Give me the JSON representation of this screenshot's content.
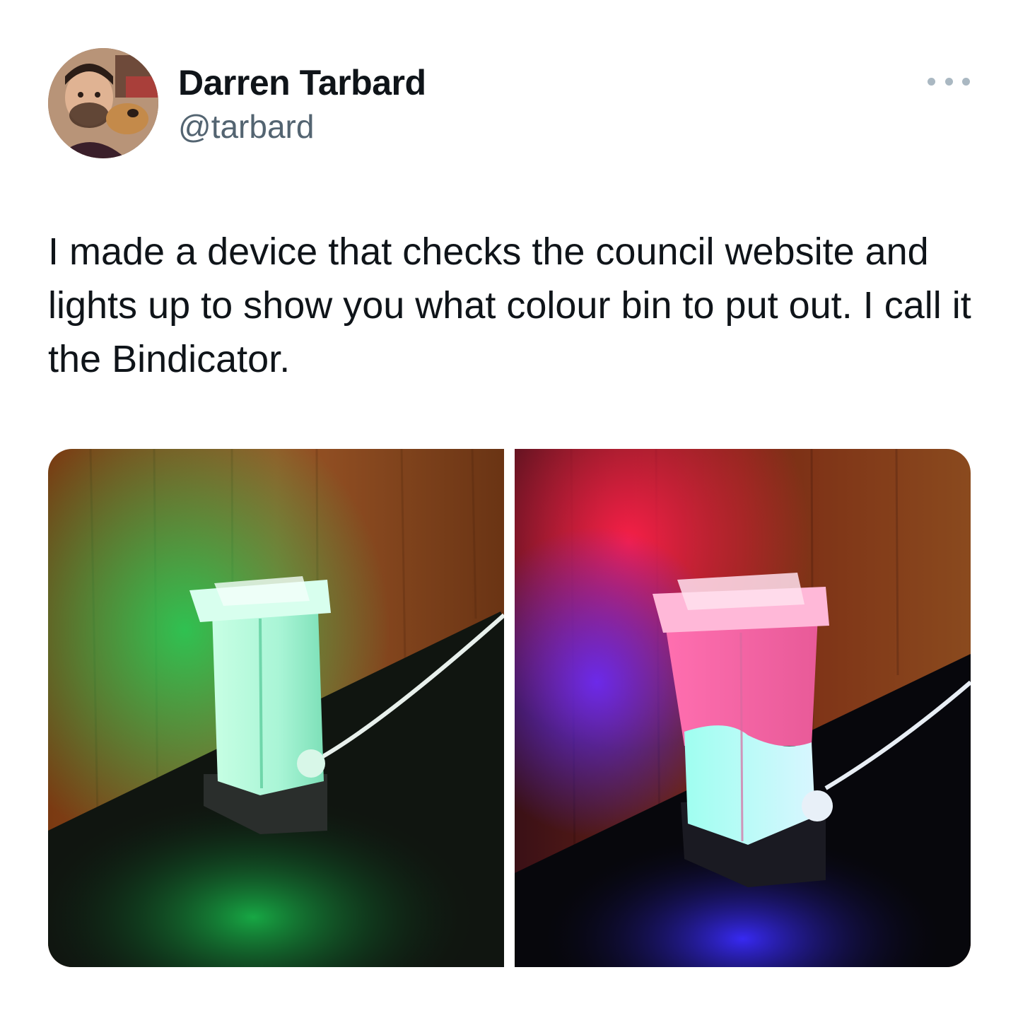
{
  "tweet": {
    "author": {
      "display_name": "Darren Tarbard",
      "handle": "@tarbard"
    },
    "more_icon": "more-horizontal-icon",
    "text": "I made a device that checks the council website and lights up to show you what colour bin to put out. I call it the Bindicator.",
    "media": [
      {
        "description_icon": "photo",
        "glow_color": "#1fd65a"
      },
      {
        "description_icon": "photo",
        "glow_color": "#ff1f4a"
      }
    ]
  },
  "colors": {
    "text_primary": "#0f1419",
    "text_secondary": "#536471",
    "green_glow": "#1fd65a",
    "red_glow": "#ff1f4a",
    "blue_glow": "#4a2bff",
    "wood": "#8a4a1e"
  }
}
